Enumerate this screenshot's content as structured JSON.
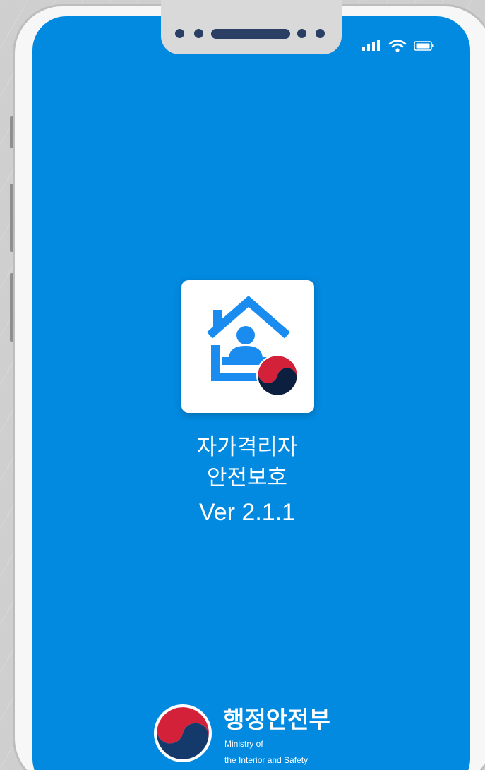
{
  "app": {
    "name_line1": "자가격리자",
    "name_line2": "안전보호",
    "version": "Ver 2.1.1"
  },
  "ministry": {
    "name_ko": "행정안전부",
    "name_en_line1": "Ministry of",
    "name_en_line2": "the Interior and Safety"
  },
  "status_bar": {
    "icons": [
      "signal-icon",
      "wifi-icon",
      "battery-icon"
    ]
  },
  "colors": {
    "splash_background": "#028ae0",
    "icon_blue": "#1a8cf0",
    "emblem_red": "#d3213a",
    "emblem_navy": "#143a6b",
    "frame": "#f7f7f7"
  }
}
